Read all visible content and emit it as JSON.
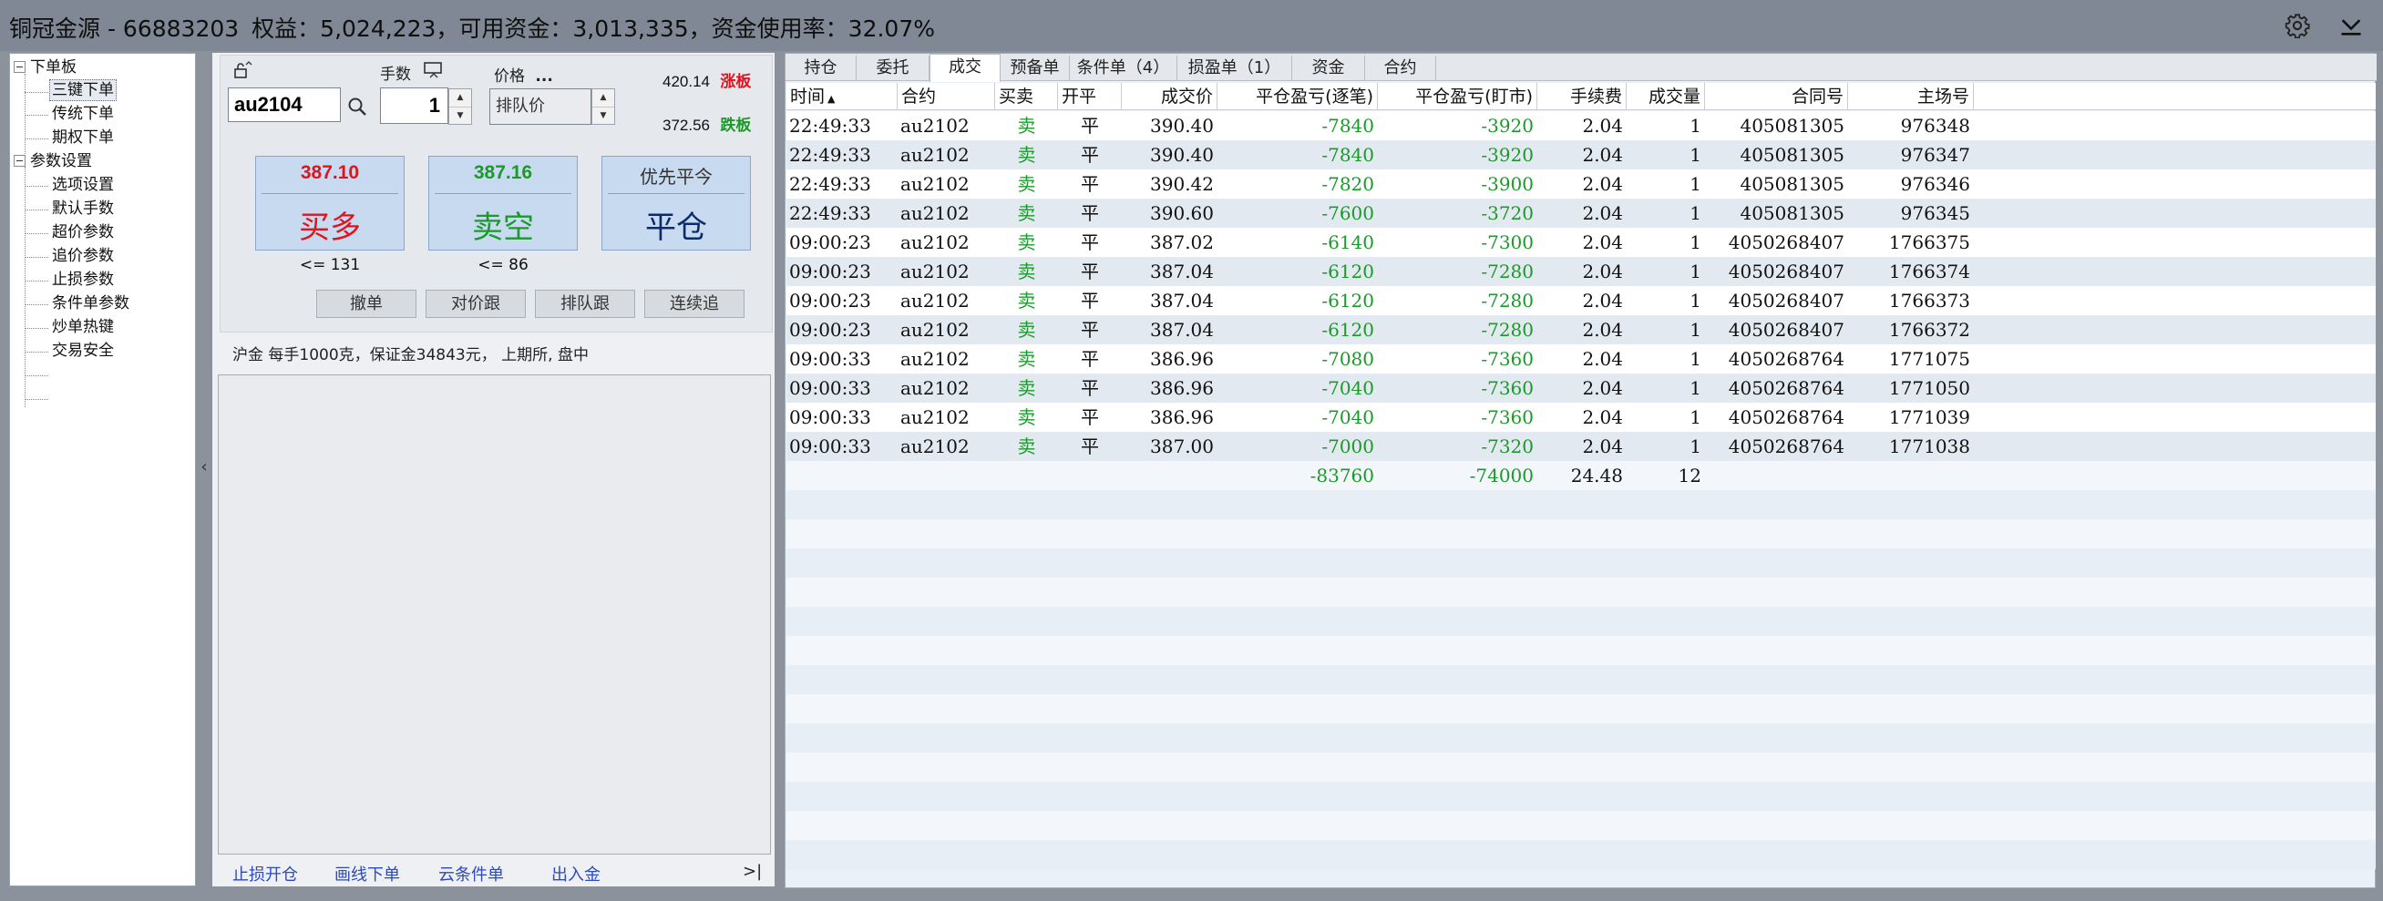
{
  "titlebar": {
    "account": "铜冠金源 - 66883203",
    "equity": "权益：5,024,223，",
    "available": "可用资金：3,013,335，",
    "usage": "资金使用率：32.07%"
  },
  "tree": {
    "root1": "下单板",
    "root1_items": [
      "三键下单",
      "传统下单",
      "期权下单"
    ],
    "root2": "参数设置",
    "root2_items": [
      "选项设置",
      "默认手数",
      "超价参数",
      "追价参数",
      "止损参数",
      "条件单参数",
      "炒单热键",
      "交易安全"
    ]
  },
  "order": {
    "symbol": "au2104",
    "qty_label": "手数",
    "qty": "1",
    "price_label": "价格",
    "price_more": "...",
    "price_type": "排队价",
    "limit_up_value": "420.14",
    "limit_up_label": "涨板",
    "limit_down_value": "372.56",
    "limit_down_label": "跌板",
    "buy_price": "387.10",
    "buy_label": "买多",
    "sell_price": "387.16",
    "sell_label": "卖空",
    "close_top": "优先平今",
    "close_label": "平仓",
    "buy_limit": "<= 131",
    "sell_limit": "<= 86",
    "btn_cancel": "撤单",
    "btn_counter": "对价跟",
    "btn_queue": "排队跟",
    "btn_chase": "连续追",
    "info": "沪金  每手1000克，保证金34843元， 上期所,  盘中"
  },
  "bottom_links": [
    "止损开仓",
    "画线下单",
    "云条件单",
    "出入金"
  ],
  "tabs": [
    "持仓",
    "委托",
    "成交",
    "预备单",
    "条件单（4）",
    "损盈单（1）",
    "资金",
    "合约"
  ],
  "active_tab": "成交",
  "table": {
    "headers": [
      "时间",
      "合约",
      "买卖",
      "开平",
      "成交价",
      "平仓盈亏(逐笔)",
      "平仓盈亏(盯市)",
      "手续费",
      "成交量",
      "合同号",
      "主场号"
    ],
    "rows": [
      [
        "22:49:33",
        "au2102",
        "卖",
        "平",
        "390.40",
        "-7840",
        "-3920",
        "2.04",
        "1",
        "405081305",
        "976348"
      ],
      [
        "22:49:33",
        "au2102",
        "卖",
        "平",
        "390.40",
        "-7840",
        "-3920",
        "2.04",
        "1",
        "405081305",
        "976347"
      ],
      [
        "22:49:33",
        "au2102",
        "卖",
        "平",
        "390.42",
        "-7820",
        "-3900",
        "2.04",
        "1",
        "405081305",
        "976346"
      ],
      [
        "22:49:33",
        "au2102",
        "卖",
        "平",
        "390.60",
        "-7600",
        "-3720",
        "2.04",
        "1",
        "405081305",
        "976345"
      ],
      [
        "09:00:23",
        "au2102",
        "卖",
        "平",
        "387.02",
        "-6140",
        "-7300",
        "2.04",
        "1",
        "4050268407",
        "1766375"
      ],
      [
        "09:00:23",
        "au2102",
        "卖",
        "平",
        "387.04",
        "-6120",
        "-7280",
        "2.04",
        "1",
        "4050268407",
        "1766374"
      ],
      [
        "09:00:23",
        "au2102",
        "卖",
        "平",
        "387.04",
        "-6120",
        "-7280",
        "2.04",
        "1",
        "4050268407",
        "1766373"
      ],
      [
        "09:00:23",
        "au2102",
        "卖",
        "平",
        "387.04",
        "-6120",
        "-7280",
        "2.04",
        "1",
        "4050268407",
        "1766372"
      ],
      [
        "09:00:33",
        "au2102",
        "卖",
        "平",
        "386.96",
        "-7080",
        "-7360",
        "2.04",
        "1",
        "4050268764",
        "1771075"
      ],
      [
        "09:00:33",
        "au2102",
        "卖",
        "平",
        "386.96",
        "-7040",
        "-7360",
        "2.04",
        "1",
        "4050268764",
        "1771050"
      ],
      [
        "09:00:33",
        "au2102",
        "卖",
        "平",
        "386.96",
        "-7040",
        "-7360",
        "2.04",
        "1",
        "4050268764",
        "1771039"
      ],
      [
        "09:00:33",
        "au2102",
        "卖",
        "平",
        "387.00",
        "-7000",
        "-7320",
        "2.04",
        "1",
        "4050268764",
        "1771038"
      ]
    ],
    "totals": [
      "",
      "",
      "",
      "",
      "",
      "-83760",
      "-74000",
      "24.48",
      "12",
      "",
      ""
    ]
  },
  "icons": [
    "settings-gear-icon",
    "minimize-chevron-icon",
    "lock-icon",
    "search-icon",
    "keyboard-icon",
    "collapse-left-icon",
    "expand-right-icon"
  ],
  "colors": {
    "buy_red": "#e0141e",
    "sell_green": "#1b9a2a",
    "close_navy": "#0d2a6b",
    "link_blue": "#2b49c3",
    "loss_green": "#1b9a2a"
  }
}
